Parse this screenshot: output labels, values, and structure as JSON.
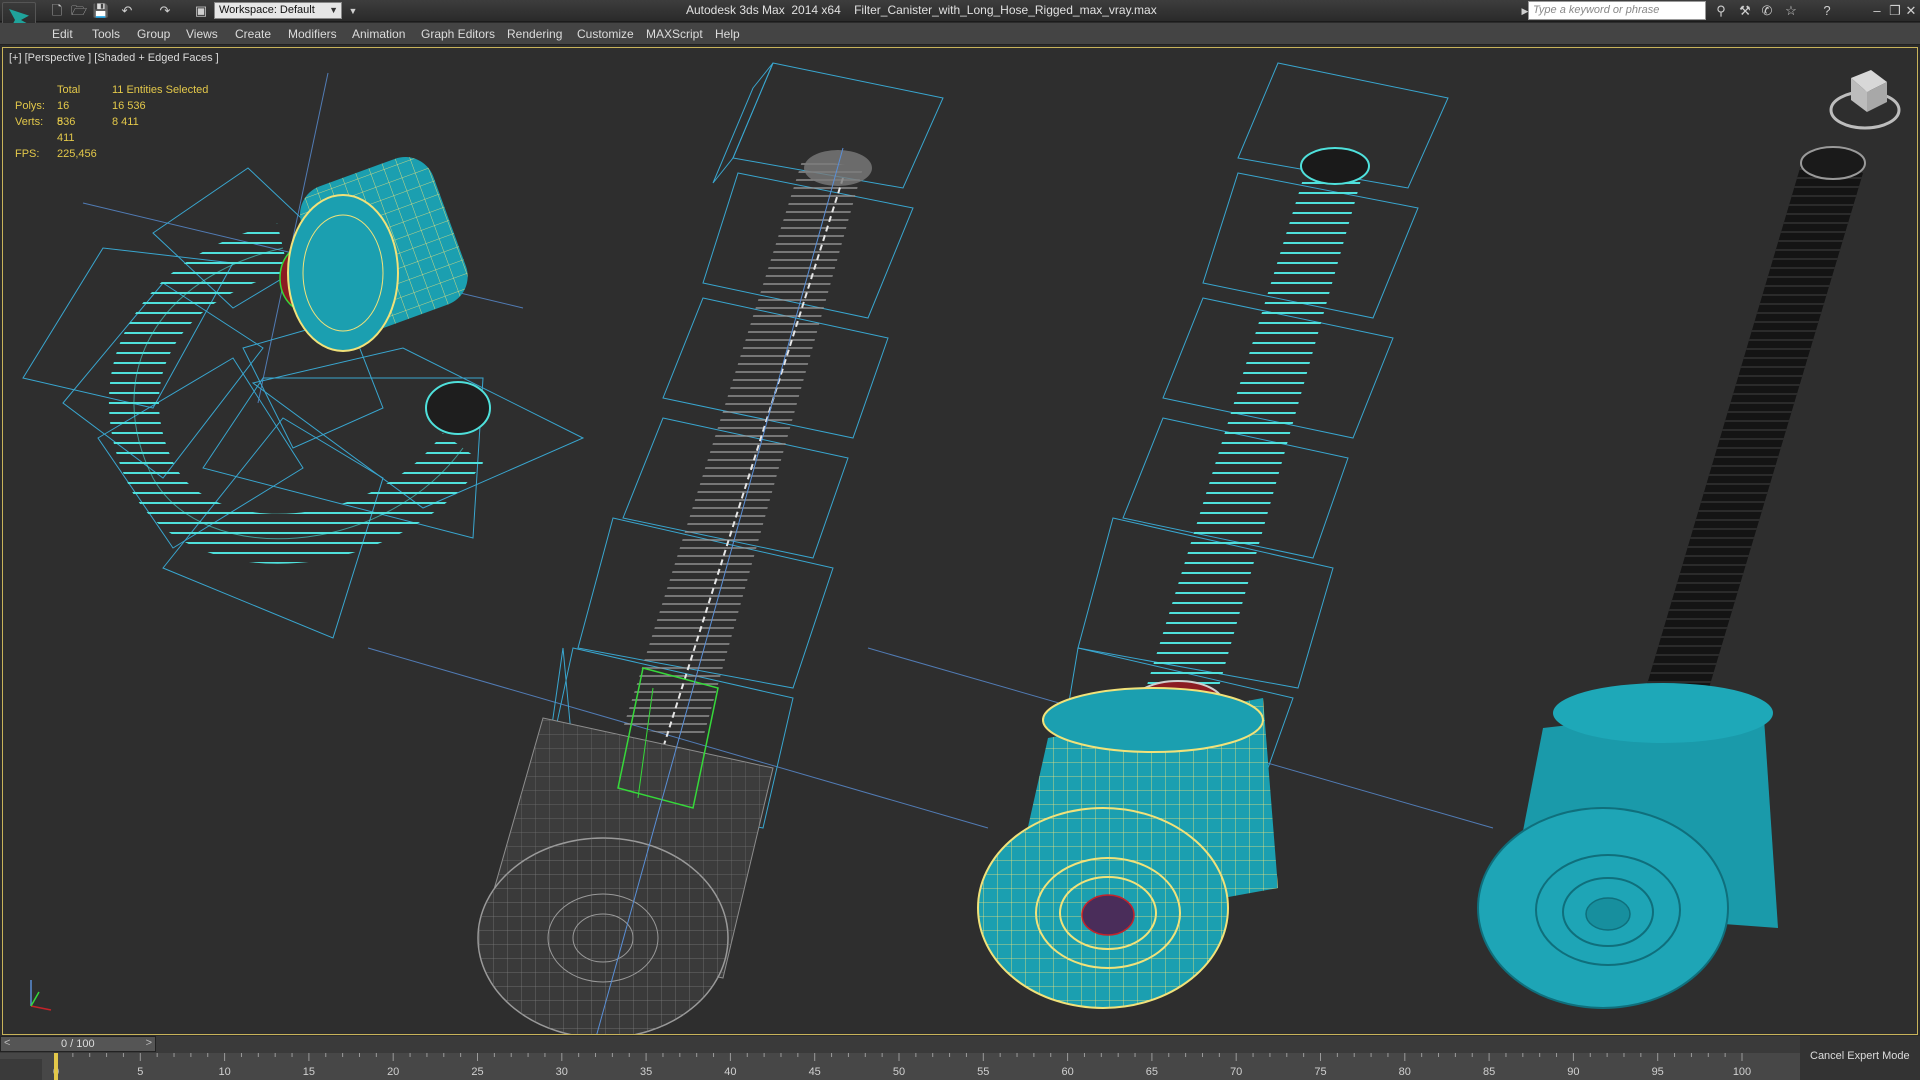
{
  "titlebar": {
    "workspace_label": "Workspace: Default",
    "title": "Autodesk 3ds Max  2014 x64    Filter_Canister_with_Long_Hose_Rigged_max_vray.max",
    "search_placeholder": "Type a keyword or phrase"
  },
  "menu": [
    "Edit",
    "Tools",
    "Group",
    "Views",
    "Create",
    "Modifiers",
    "Animation",
    "Graph Editors",
    "Rendering",
    "Customize",
    "MAXScript",
    "Help"
  ],
  "viewport": {
    "label": "[+] [Perspective ] [Shaded + Edged Faces ]",
    "stats": {
      "header": [
        "Total",
        "11 Entities Selected"
      ],
      "polys": [
        "Polys:",
        "16 536",
        "16 536"
      ],
      "verts": [
        "Verts:",
        "8 411",
        "8 411"
      ],
      "fps": [
        "FPS:",
        "225,456"
      ]
    }
  },
  "timeline": {
    "frame_label": "0 / 100",
    "ticks": [
      "0",
      "5",
      "10",
      "15",
      "20",
      "25",
      "30",
      "35",
      "40",
      "45",
      "50",
      "55",
      "60",
      "65",
      "70",
      "75",
      "80",
      "85",
      "90",
      "95",
      "100"
    ],
    "cancel_expert": "Cancel Expert Mode"
  },
  "colors": {
    "cyan": "#1b9fb0",
    "wire_cyan": "#4fe1dc",
    "wire_yellow": "#f1e27a",
    "bbox_blue": "#39a6cf",
    "grey_mesh": "#8d8d8d",
    "selection_red": "#c3232a",
    "green_gizmo": "#36d93a"
  }
}
